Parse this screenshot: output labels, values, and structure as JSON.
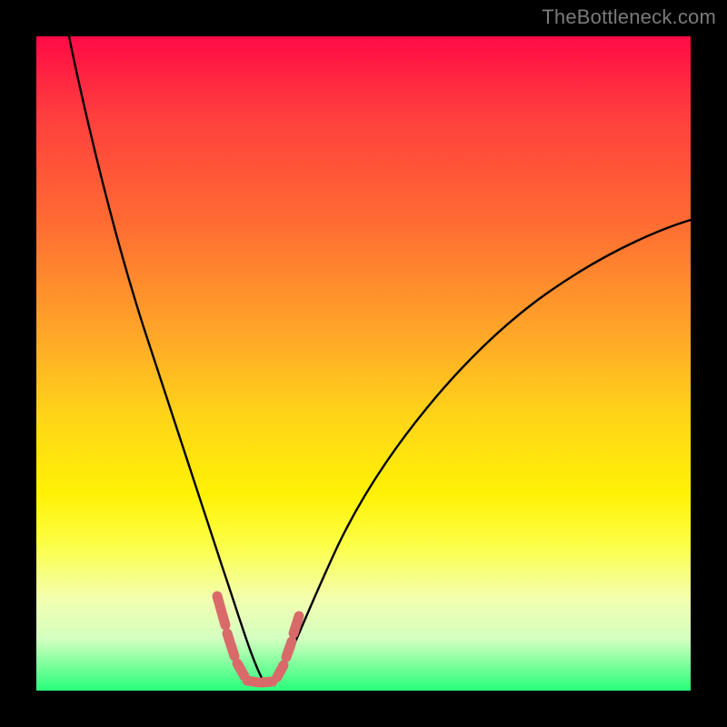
{
  "watermark": {
    "text": "TheBottleneck.com"
  },
  "colors": {
    "background": "#000000",
    "curve_stroke": "#000000",
    "overlay_stroke": "#d86a6a",
    "gradient_stops": [
      "#ff0b46",
      "#ff3e3e",
      "#ff6a33",
      "#ffa528",
      "#ffd419",
      "#fff205",
      "#fcff4a",
      "#f3ffb0",
      "#d4ffc0",
      "#28ff7a"
    ]
  },
  "chart_data": {
    "type": "line",
    "title": "",
    "xlabel": "",
    "ylabel": "",
    "xlim": [
      0,
      100
    ],
    "ylim": [
      0,
      100
    ],
    "grid": false,
    "legend": false,
    "note": "No axis ticks or numeric labels present; values estimated from pixel positions on a normalized 0–100 scale. Curve is a V/notch shape with minimum near x≈33.",
    "series": [
      {
        "name": "bottleneck-curve",
        "style": "black-thin",
        "x": [
          5,
          8,
          12,
          16,
          20,
          24,
          27,
          30,
          32,
          33,
          34,
          36,
          38,
          41,
          46,
          52,
          60,
          70,
          82,
          96,
          100
        ],
        "y": [
          100,
          87,
          71,
          56,
          42,
          29,
          18,
          9,
          3,
          1,
          1,
          3,
          7,
          13,
          22,
          32,
          43,
          54,
          63,
          70,
          72
        ]
      },
      {
        "name": "highlight-valley",
        "style": "pink-thick-dashed",
        "x": [
          27.5,
          28.5,
          30,
          31.5,
          33,
          35,
          36.5,
          38,
          39,
          40
        ],
        "y": [
          14,
          10,
          5.5,
          2.5,
          1,
          1.5,
          3.5,
          6,
          9,
          12
        ]
      }
    ]
  }
}
